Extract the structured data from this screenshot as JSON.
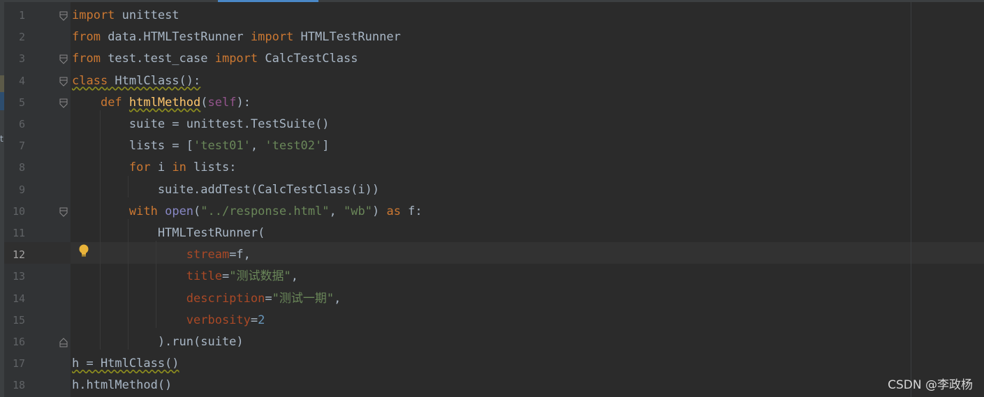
{
  "editor": {
    "active_line": 12,
    "line_numbers": [
      "1",
      "2",
      "3",
      "4",
      "5",
      "6",
      "7",
      "8",
      "9",
      "10",
      "11",
      "12",
      "13",
      "14",
      "15",
      "16",
      "17",
      "18"
    ],
    "lines": [
      [
        {
          "t": "import",
          "c": "kw"
        },
        {
          "t": " unittest",
          "c": ""
        }
      ],
      [
        {
          "t": "from",
          "c": "kw"
        },
        {
          "t": " data.HTMLTestRunner ",
          "c": ""
        },
        {
          "t": "import",
          "c": "kw"
        },
        {
          "t": " HTMLTestRunner",
          "c": ""
        }
      ],
      [
        {
          "t": "from",
          "c": "kw"
        },
        {
          "t": " test.test_case ",
          "c": ""
        },
        {
          "t": "import",
          "c": "kw"
        },
        {
          "t": " CalcTestClass",
          "c": ""
        }
      ],
      [
        {
          "t": "class",
          "c": "kw wavy"
        },
        {
          "t": " HtmlClass():",
          "c": "wavy"
        }
      ],
      [
        {
          "t": "    ",
          "c": ""
        },
        {
          "t": "def",
          "c": "kw"
        },
        {
          "t": " ",
          "c": ""
        },
        {
          "t": "htmlMethod",
          "c": "fn wavy"
        },
        {
          "t": "(",
          "c": ""
        },
        {
          "t": "self",
          "c": "self"
        },
        {
          "t": "):",
          "c": ""
        }
      ],
      [
        {
          "t": "        suite = unittest.TestSuite()",
          "c": ""
        }
      ],
      [
        {
          "t": "        lists = [",
          "c": ""
        },
        {
          "t": "'test01'",
          "c": "str"
        },
        {
          "t": ", ",
          "c": ""
        },
        {
          "t": "'test02'",
          "c": "str"
        },
        {
          "t": "]",
          "c": ""
        }
      ],
      [
        {
          "t": "        ",
          "c": ""
        },
        {
          "t": "for",
          "c": "kw"
        },
        {
          "t": " i ",
          "c": ""
        },
        {
          "t": "in",
          "c": "kw"
        },
        {
          "t": " lists:",
          "c": ""
        }
      ],
      [
        {
          "t": "            suite.addTest(CalcTestClass(i))",
          "c": ""
        }
      ],
      [
        {
          "t": "        ",
          "c": ""
        },
        {
          "t": "with",
          "c": "kw"
        },
        {
          "t": " ",
          "c": ""
        },
        {
          "t": "open",
          "c": "bi"
        },
        {
          "t": "(",
          "c": ""
        },
        {
          "t": "\"../response.html\"",
          "c": "str"
        },
        {
          "t": ", ",
          "c": ""
        },
        {
          "t": "\"wb\"",
          "c": "str"
        },
        {
          "t": ") ",
          "c": ""
        },
        {
          "t": "as",
          "c": "kw"
        },
        {
          "t": " f:",
          "c": ""
        }
      ],
      [
        {
          "t": "            HTMLTestRunner(",
          "c": ""
        }
      ],
      [
        {
          "t": "                ",
          "c": ""
        },
        {
          "t": "stream",
          "c": "param"
        },
        {
          "t": "=f,",
          "c": ""
        }
      ],
      [
        {
          "t": "                ",
          "c": ""
        },
        {
          "t": "title",
          "c": "param"
        },
        {
          "t": "=",
          "c": ""
        },
        {
          "t": "\"测试数据\"",
          "c": "str"
        },
        {
          "t": ",",
          "c": ""
        }
      ],
      [
        {
          "t": "                ",
          "c": ""
        },
        {
          "t": "description",
          "c": "param"
        },
        {
          "t": "=",
          "c": ""
        },
        {
          "t": "\"测试一期\"",
          "c": "str"
        },
        {
          "t": ",",
          "c": ""
        }
      ],
      [
        {
          "t": "                ",
          "c": ""
        },
        {
          "t": "verbosity",
          "c": "param"
        },
        {
          "t": "=",
          "c": ""
        },
        {
          "t": "2",
          "c": "num"
        }
      ],
      [
        {
          "t": "            ).run(suite)",
          "c": ""
        }
      ],
      [
        {
          "t": "h = HtmlClass()",
          "c": "wavy"
        }
      ],
      [
        {
          "t": "h.htmlMethod()",
          "c": ""
        }
      ]
    ],
    "folds": [
      1,
      3,
      4,
      5,
      10,
      16
    ],
    "intention_icon": "lightbulb-icon"
  },
  "side_panel": {
    "stub_label": "t"
  },
  "watermark": "CSDN @李政杨",
  "colors": {
    "background": "#2b2b2b",
    "keyword": "#cc7832",
    "string": "#6a8759",
    "function": "#ffc66d",
    "parameter": "#aa4926",
    "number": "#6897bb",
    "self": "#94558d",
    "builtin": "#8888c6",
    "text": "#a9b7c6"
  }
}
